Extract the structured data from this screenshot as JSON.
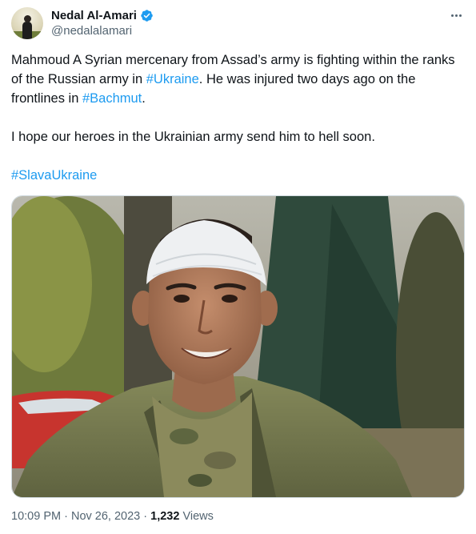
{
  "author": {
    "display_name": "Nedal Al-Amari",
    "handle": "@nedalalamari",
    "verified_color": "#1d9bf0"
  },
  "tweet": {
    "line1_text_a": "Mahmoud A Syrian mercenary from Assad’s army is fighting within the ranks of the Russian army in ",
    "hashtag_ukraine": "#Ukraine",
    "line1_text_b": ". He was injured two days ago on the frontlines in ",
    "hashtag_bachmut": "#Bachmut",
    "line1_text_c": ".",
    "paragraph2": "I hope our heroes in the Ukrainian army send him to hell soon.",
    "hashtag_slava": "#SlavaUkraine"
  },
  "meta": {
    "time": "10:09 PM",
    "separator": " · ",
    "date": "Nov 26, 2023",
    "views_count": "1,232",
    "views_label": " Views"
  },
  "colors": {
    "link": "#1d9bf0",
    "secondary_text": "#536471",
    "primary_text": "#0f1419"
  },
  "icons": {
    "more": "more-horizontal-icon",
    "verified": "verified-badge-icon"
  }
}
